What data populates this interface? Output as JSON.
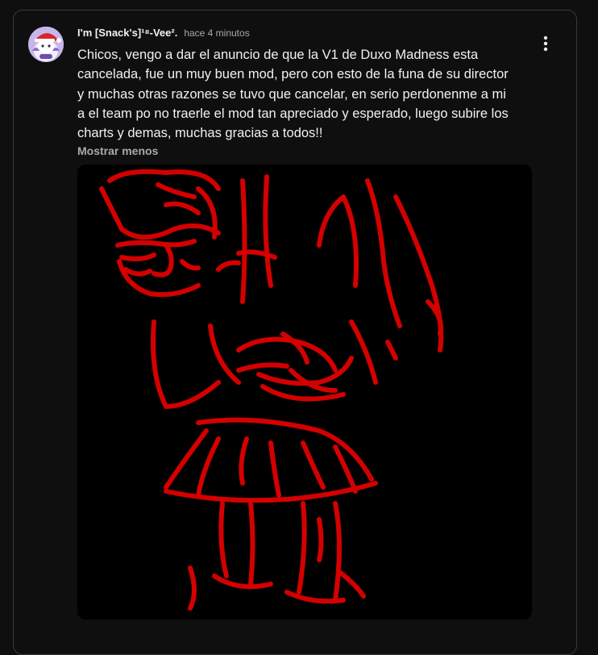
{
  "post": {
    "author": "I'm [Snack's]¹⁸-Vee².",
    "time": "hace 4 minutos",
    "text": "Chicos, vengo a dar el anuncio de que la V1 de Duxo Madness esta cancelada, fue un muy buen mod, pero con esto de la funa de su director y muchas otras razones se tuvo que cancelar, en serio perdonenme a mi a el team po no traerle el mod tan apreciado y esperado, luego subire los charts y demas, muchas gracias a todos!!",
    "toggle_label": "Mostrar menos",
    "menu_icon": "more-vert-icon",
    "image": {
      "subject": "red sketch drawing on black background",
      "stroke_color": "#e00000",
      "background_color": "#000000"
    }
  },
  "colors": {
    "background": "#0f0f0f",
    "border": "#3a3a3a",
    "text_primary": "#f1f1f1",
    "text_secondary": "#aaaaaa"
  }
}
